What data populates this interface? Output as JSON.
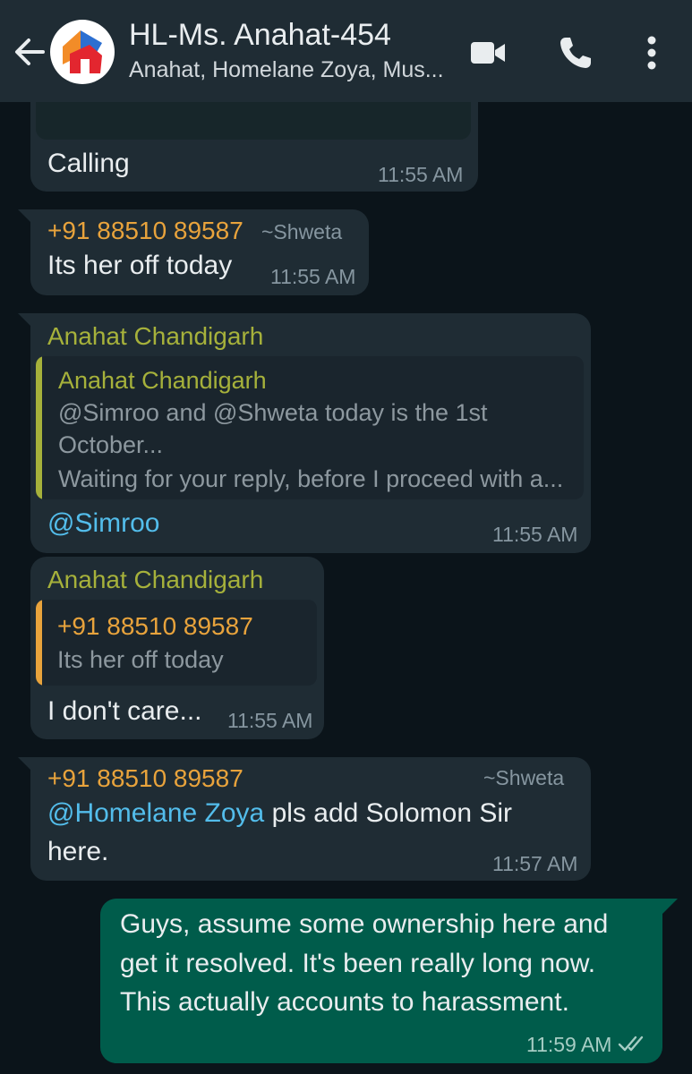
{
  "header": {
    "title": "HL-Ms. Anahat-454",
    "subtitle": "Anahat, Homelane Zoya, Mus...",
    "icons": [
      "back-arrow-icon",
      "group-avatar",
      "video-call-icon",
      "voice-call-icon",
      "more-options-icon"
    ]
  },
  "messages": [
    {
      "text": "Calling",
      "time": "11:55 AM"
    },
    {
      "sender_phone": "+91 88510 89587",
      "sender_name": "~Shweta",
      "text": "Its her off today",
      "time": "11:55 AM"
    },
    {
      "sender": "Anahat Chandigarh",
      "quote": {
        "sender": "Anahat Chandigarh",
        "line1": "@Simroo and @Shweta today is the 1st",
        "line2": "October...",
        "line3": "Waiting for your reply, before I proceed with a..."
      },
      "text": "@Simroo",
      "time": "11:55 AM"
    },
    {
      "sender": "Anahat Chandigarh",
      "quote": {
        "sender": "+91 88510 89587",
        "line1": "Its her off today"
      },
      "text": "I don't care...",
      "time": "11:55 AM"
    },
    {
      "sender_phone": "+91 88510 89587",
      "sender_name": "~Shweta",
      "mention": "@Homelane Zoya",
      "text1": " pls add Solomon Sir",
      "text2": "here.",
      "time": "11:57 AM"
    },
    {
      "line1": "Guys, assume some ownership here and",
      "line2": "get it resolved. It's been really long now.",
      "line3": "This actually accounts to harassment.",
      "time": "11:59 AM",
      "status": "read-double-tick-icon"
    }
  ],
  "colors": {
    "background": "#0b141a",
    "header": "#1f2c34",
    "incoming": "#1f2c34",
    "outgoing": "#005c4b",
    "phone": "#e8a33c",
    "sender": "#a6b13b",
    "mention": "#53bdeb"
  }
}
